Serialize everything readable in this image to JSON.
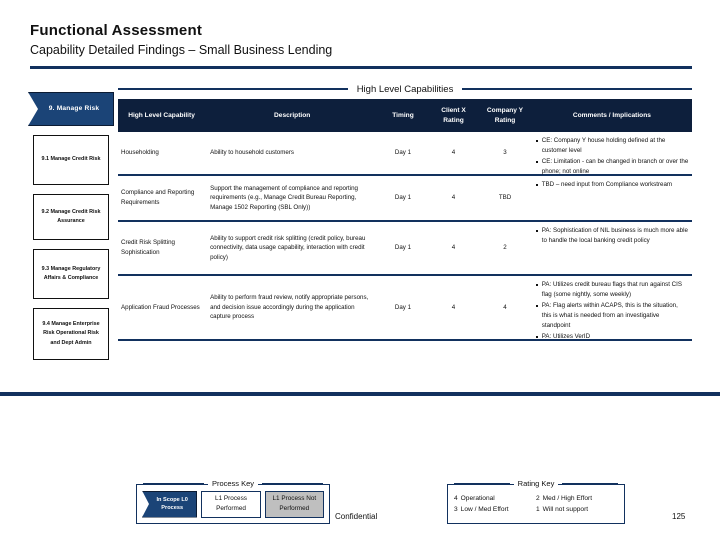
{
  "header": {
    "title": "Functional Assessment",
    "subtitle": "Capability Detailed Findings – Small Business Lending"
  },
  "section_band": {
    "caption": "High Level Capabilities"
  },
  "process_column": {
    "chevron_label": "9. Manage Risk",
    "boxes": [
      {
        "label": "9.1 Manage Credit Risk"
      },
      {
        "label": "9.2 Manage Credit Risk Assurance"
      },
      {
        "label": "9.3 Manage Regulatory Affairs & Compliance"
      },
      {
        "label": "9.4 Manage Enterprise Risk Operational Risk and Dept Admin"
      }
    ]
  },
  "table": {
    "columns": [
      {
        "key": "capability",
        "label": "High Level Capability"
      },
      {
        "key": "description",
        "label": "Description"
      },
      {
        "key": "timing",
        "label": "Timing"
      },
      {
        "key": "client_rating",
        "label": "Client X Rating"
      },
      {
        "key": "company_rating",
        "label": "Company Y Rating"
      },
      {
        "key": "comments",
        "label": "Comments / Implications"
      }
    ],
    "rows": [
      {
        "capability": "Householding",
        "description": "Ability to household customers",
        "timing": "Day 1",
        "client_rating": "4",
        "company_rating": "3",
        "comments": [
          "CE: Company Y house holding defined at the customer level",
          "CE: Limitation - can be changed in branch or over the phone; not online"
        ]
      },
      {
        "capability": "Compliance and Reporting Requirements",
        "description": "Support the management of compliance and reporting requirements (e.g., Manage Credit Bureau Reporting, Manage 1502 Reporting (SBL Only))",
        "timing": "Day 1",
        "client_rating": "4",
        "company_rating": "TBD",
        "comments": [
          "TBD – need input from Compliance workstream"
        ]
      },
      {
        "capability": "Credit Risk Splitting Sophistication",
        "description": "Ability to support credit risk splitting (credit policy, bureau connectivity, data usage capability, interaction with credit policy)",
        "timing": "Day 1",
        "client_rating": "4",
        "company_rating": "2",
        "comments": [
          "PA: Sophistication of NIL business is much more able to handle the local banking credit policy"
        ]
      },
      {
        "capability": "Application Fraud Processes",
        "description": "Ability to perform fraud review, notify appropriate persons, and decision issue accordingly during the application capture process",
        "timing": "Day 1",
        "client_rating": "4",
        "company_rating": "4",
        "comments": [
          "PA: Utilizes credit bureau flags that run against CIS flag (some nightly, some weekly)",
          "PA: Flag alerts within ACAPS, this is the situation, this is what is needed from an investigative standpoint",
          "PA: Utilizes VerID"
        ]
      }
    ]
  },
  "process_key": {
    "caption": "Process Key",
    "in_scope_label": "In Scope L0 Process",
    "performed_label": "L1 Process Performed",
    "not_performed_label": "L1 Process Not Performed"
  },
  "rating_key": {
    "caption": "Rating Key",
    "items": [
      {
        "num": "4",
        "text": "Operational"
      },
      {
        "num": "2",
        "text": "Med / High Effort"
      },
      {
        "num": "3",
        "text": "Low / Med Effort"
      },
      {
        "num": "1",
        "text": "Will not support"
      }
    ]
  },
  "footer": {
    "confidential": "Confidential",
    "page_number": "125"
  },
  "colors": {
    "navy_dark": "#0d1f3c",
    "navy_rule": "#12315e",
    "chevron_blue": "#1b4477",
    "grey_fill": "#bfbfbf"
  }
}
